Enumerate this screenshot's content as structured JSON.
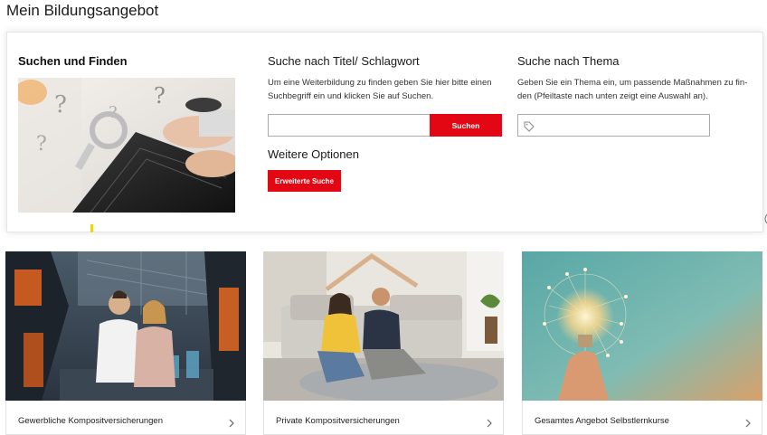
{
  "page": {
    "title": "Mein Bildungsangebot"
  },
  "search_panel": {
    "intro_title": "Suchen und Finden",
    "keyword": {
      "title": "Suche nach Titel/ Schlagwort",
      "description": "Um eine Weiterbildung zu finden geben Sie hier bitte einen Suchbegriff ein und klicken Sie auf Suchen.",
      "input_value": "",
      "button_label": "Suchen"
    },
    "more_options": {
      "title": "Weitere Optionen",
      "button_label": "Erweiterte Suche"
    },
    "topic": {
      "title": "Suche nach Thema",
      "description": "Geben Sie ein Thema ein, um passende Maßnahmen zu fin-den (Pfeiltaste nach unten zeigt eine Auswahl an).",
      "input_value": ""
    }
  },
  "cards": [
    {
      "label": "Gewerbliche Kompositversicherungen"
    },
    {
      "label": "Private Kompositversicherungen"
    },
    {
      "label": "Gesamtes Angebot Selbstlernkurse"
    }
  ],
  "colors": {
    "accent": "#e30613",
    "highlight": "#f2d600"
  },
  "icons": [
    "tag-icon",
    "chevron-right-icon"
  ]
}
